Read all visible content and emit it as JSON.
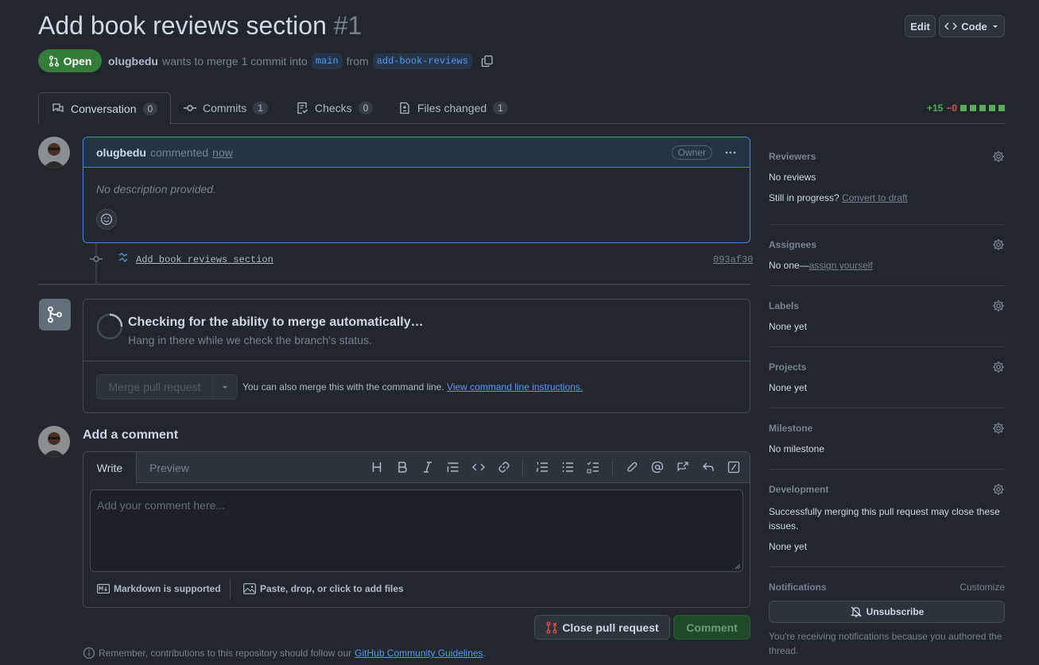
{
  "header": {
    "title": "Add book reviews section",
    "number": "#1",
    "edit_label": "Edit",
    "code_label": "Code"
  },
  "state": {
    "label": "Open",
    "author": "olugbedu",
    "merge_text": "wants to merge 1 commit into",
    "base_branch": "main",
    "from_text": "from",
    "head_branch": "add-book-reviews"
  },
  "tabs": [
    {
      "label": "Conversation",
      "count": "0"
    },
    {
      "label": "Commits",
      "count": "1"
    },
    {
      "label": "Checks",
      "count": "0"
    },
    {
      "label": "Files changed",
      "count": "1"
    }
  ],
  "diffstat": {
    "additions": "+15",
    "deletions": "−0"
  },
  "comment": {
    "author": "olugbedu",
    "action": "commented",
    "time": "now",
    "badge": "Owner",
    "body": "No description provided."
  },
  "commit": {
    "message": "Add book reviews section",
    "sha": "093af30"
  },
  "merge": {
    "title": "Checking for the ability to merge automatically…",
    "subtitle": "Hang in there while we check the branch's status.",
    "button_label": "Merge pull request",
    "hint": "You can also merge this with the command line.",
    "link": "View command line instructions."
  },
  "add_comment": {
    "heading": "Add a comment",
    "tab_write": "Write",
    "tab_preview": "Preview",
    "placeholder": "Add your comment here...",
    "markdown_label": "Markdown is supported",
    "files_label": "Paste, drop, or click to add files",
    "close_label": "Close pull request",
    "comment_label": "Comment"
  },
  "footer": {
    "text": "Remember, contributions to this repository should follow our",
    "link": "GitHub Community Guidelines",
    "end": "."
  },
  "sidebar": {
    "reviewers": {
      "title": "Reviewers",
      "value": "No reviews",
      "progress": "Still in progress?",
      "draft_link": "Convert to draft"
    },
    "assignees": {
      "title": "Assignees",
      "value": "No one—",
      "link": "assign yourself"
    },
    "labels": {
      "title": "Labels",
      "value": "None yet"
    },
    "projects": {
      "title": "Projects",
      "value": "None yet"
    },
    "milestone": {
      "title": "Milestone",
      "value": "No milestone"
    },
    "development": {
      "title": "Development",
      "desc": "Successfully merging this pull request may close these issues.",
      "value": "None yet"
    },
    "notifications": {
      "title": "Notifications",
      "customize": "Customize",
      "button": "Unsubscribe",
      "note": "You're receiving notifications because you authored the thread."
    }
  },
  "colors": {
    "accent": "#4184e4",
    "open": "#347d39",
    "danger": "#e5534b",
    "bg": "#22272e"
  }
}
